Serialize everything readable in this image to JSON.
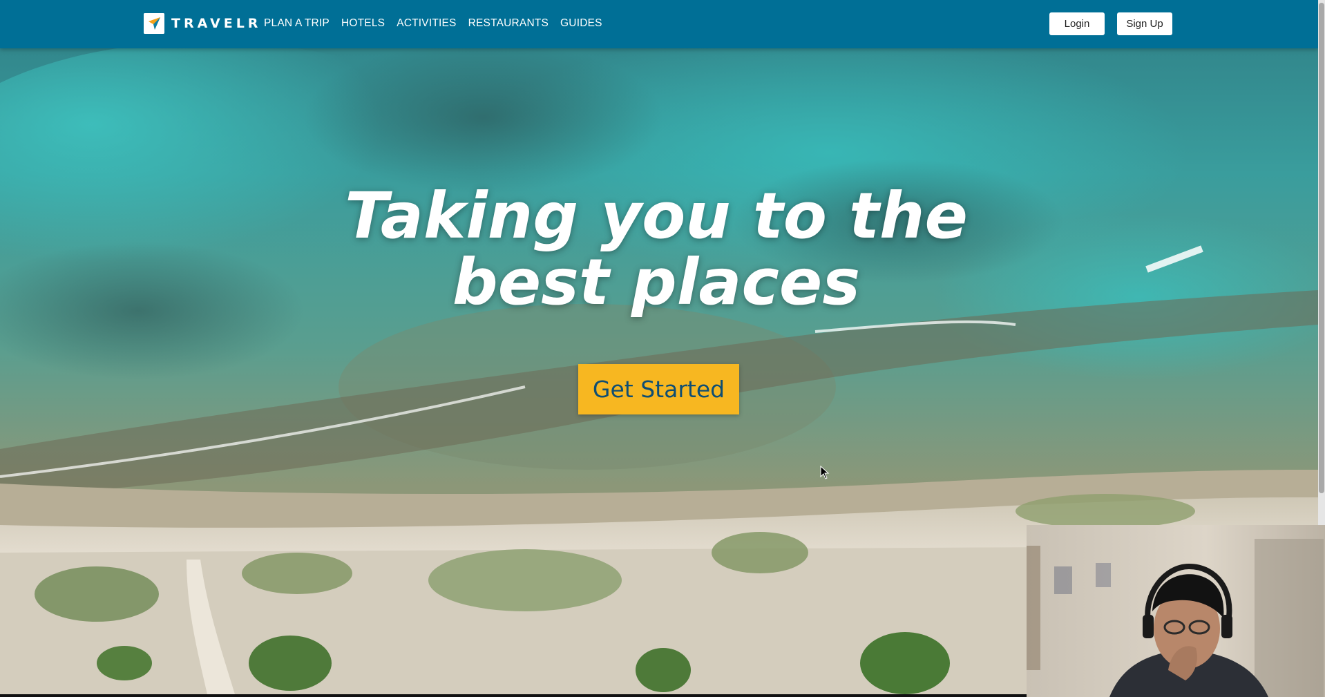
{
  "brand": {
    "name": "TRAVELR",
    "logo_icon": "paper-plane-logo-icon"
  },
  "nav": {
    "links": [
      {
        "label": "PLAN A TRIP"
      },
      {
        "label": "HOTELS"
      },
      {
        "label": "ACTIVITIES"
      },
      {
        "label": "RESTAURANTS"
      },
      {
        "label": "GUIDES"
      }
    ],
    "login_label": "Login",
    "signup_label": "Sign Up"
  },
  "hero": {
    "title_line1": "Taking you to the",
    "title_line2": "best places",
    "cta_label": "Get Started",
    "background": "aerial-coastline-reef-photo"
  },
  "webcam": {
    "description_icon": "presenter-webcam-feed"
  },
  "colors": {
    "navbar": "#006f96",
    "cta_background": "#f7b721",
    "cta_text": "#0f4e73",
    "hero_text": "#ffffff"
  }
}
